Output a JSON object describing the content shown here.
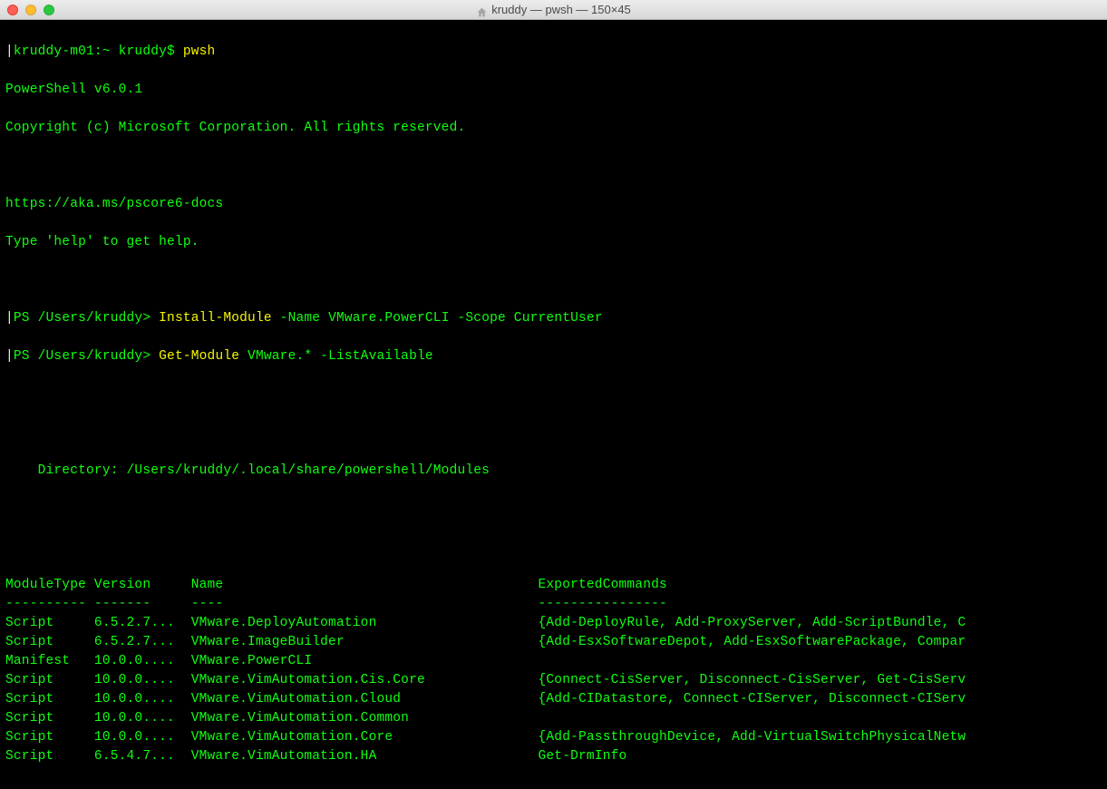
{
  "window": {
    "title": "kruddy — pwsh — 150×45"
  },
  "shell_prompt": {
    "host": "kruddy-m01:~ kruddy$",
    "cmd": "pwsh"
  },
  "banner": {
    "l1": "PowerShell v6.0.1",
    "l2": "Copyright (c) Microsoft Corporation. All rights reserved.",
    "l3": "https://aka.ms/pscore6-docs",
    "l4": "Type 'help' to get help."
  },
  "ps_prompts": [
    {
      "prompt": "PS /Users/kruddy> ",
      "cmd": "Install-Module",
      "args": " -Name VMware.PowerCLI -Scope CurrentUser"
    },
    {
      "prompt": "PS /Users/kruddy> ",
      "cmd": "Get-Module",
      "args": " VMware.* -ListAvailable"
    }
  ],
  "directory_line": "    Directory: /Users/kruddy/.local/share/powershell/Modules",
  "table": {
    "headers": {
      "type": "ModuleType",
      "version": "Version",
      "name": "Name",
      "exported": "ExportedCommands"
    },
    "dashes": {
      "type": "----------",
      "version": "-------",
      "name": "----",
      "exported": "----------------"
    },
    "rows": [
      {
        "type": "Script",
        "version": "6.5.2.7...",
        "name": "VMware.DeployAutomation",
        "exported": "{Add-DeployRule, Add-ProxyServer, Add-ScriptBundle, C"
      },
      {
        "type": "Script",
        "version": "6.5.2.7...",
        "name": "VMware.ImageBuilder",
        "exported": "{Add-EsxSoftwareDepot, Add-EsxSoftwarePackage, Compar"
      },
      {
        "type": "Manifest",
        "version": "10.0.0....",
        "name": "VMware.PowerCLI",
        "exported": ""
      },
      {
        "type": "Script",
        "version": "10.0.0....",
        "name": "VMware.VimAutomation.Cis.Core",
        "exported": "{Connect-CisServer, Disconnect-CisServer, Get-CisServ"
      },
      {
        "type": "Script",
        "version": "10.0.0....",
        "name": "VMware.VimAutomation.Cloud",
        "exported": "{Add-CIDatastore, Connect-CIServer, Disconnect-CIServ"
      },
      {
        "type": "Script",
        "version": "10.0.0....",
        "name": "VMware.VimAutomation.Common",
        "exported": ""
      },
      {
        "type": "Script",
        "version": "10.0.0....",
        "name": "VMware.VimAutomation.Core",
        "exported": "{Add-PassthroughDevice, Add-VirtualSwitchPhysicalNetw"
      },
      {
        "type": "Script",
        "version": "6.5.4.7...",
        "name": "VMware.VimAutomation.HA",
        "exported": "Get-DrmInfo"
      }
    ]
  }
}
